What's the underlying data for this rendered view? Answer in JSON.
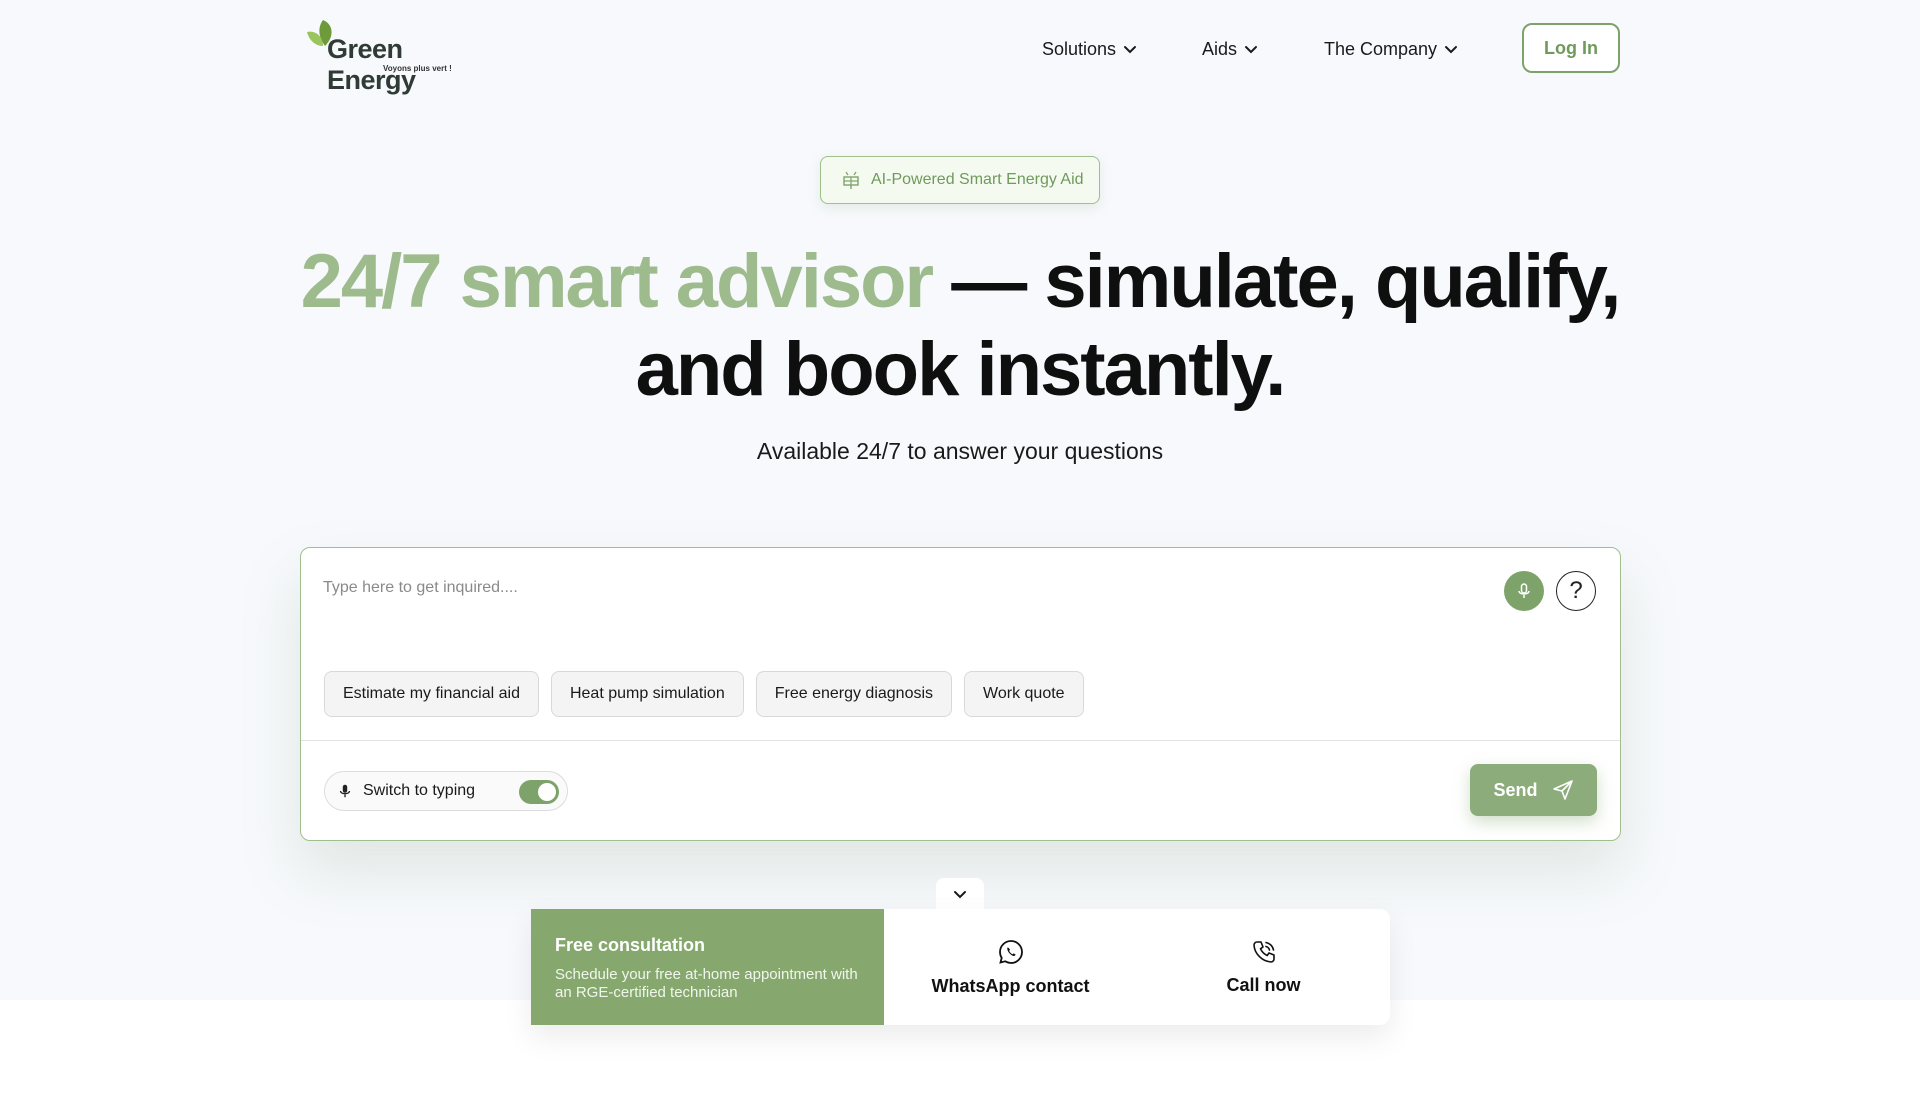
{
  "brand": {
    "name_part1": "Green",
    "name_part2": "Energy",
    "tagline": "Voyons plus vert !",
    "accent_color": "#7ea36a"
  },
  "nav": {
    "items": [
      {
        "label": "Solutions",
        "icon": "chevron-down-icon"
      },
      {
        "label": "Aids",
        "icon": "chevron-down-icon"
      },
      {
        "label": "The Company",
        "icon": "chevron-down-icon"
      }
    ],
    "login_label": "Log In"
  },
  "hero": {
    "badge": "AI-Powered Smart Energy Aid",
    "badge_icon": "solar-panel-icon",
    "headline_accent": "24/7 smart advisor",
    "headline_rest_1": " — simulate, qualify,",
    "headline_rest_2": "and book instantly.",
    "subtitle": "Available 24/7 to answer your questions"
  },
  "chat": {
    "placeholder": "Type here to get inquired....",
    "mic_icon": "microphone-icon",
    "help_icon": "question-icon",
    "chips": [
      "Estimate my financial aid",
      "Heat pump simulation",
      "Free energy diagnosis",
      "Work quote"
    ],
    "toggle_label": "Switch to typing",
    "toggle_on": true,
    "send_label": "Send",
    "send_icon": "paper-plane-icon"
  },
  "contact": {
    "consult_title": "Free consultation",
    "consult_desc": "Schedule your free at-home appointment with an RGE-certified technician",
    "whatsapp_label": "WhatsApp contact",
    "whatsapp_icon": "whatsapp-icon",
    "call_label": "Call now",
    "call_icon": "phone-icon",
    "consult_color": "#86a86e"
  }
}
